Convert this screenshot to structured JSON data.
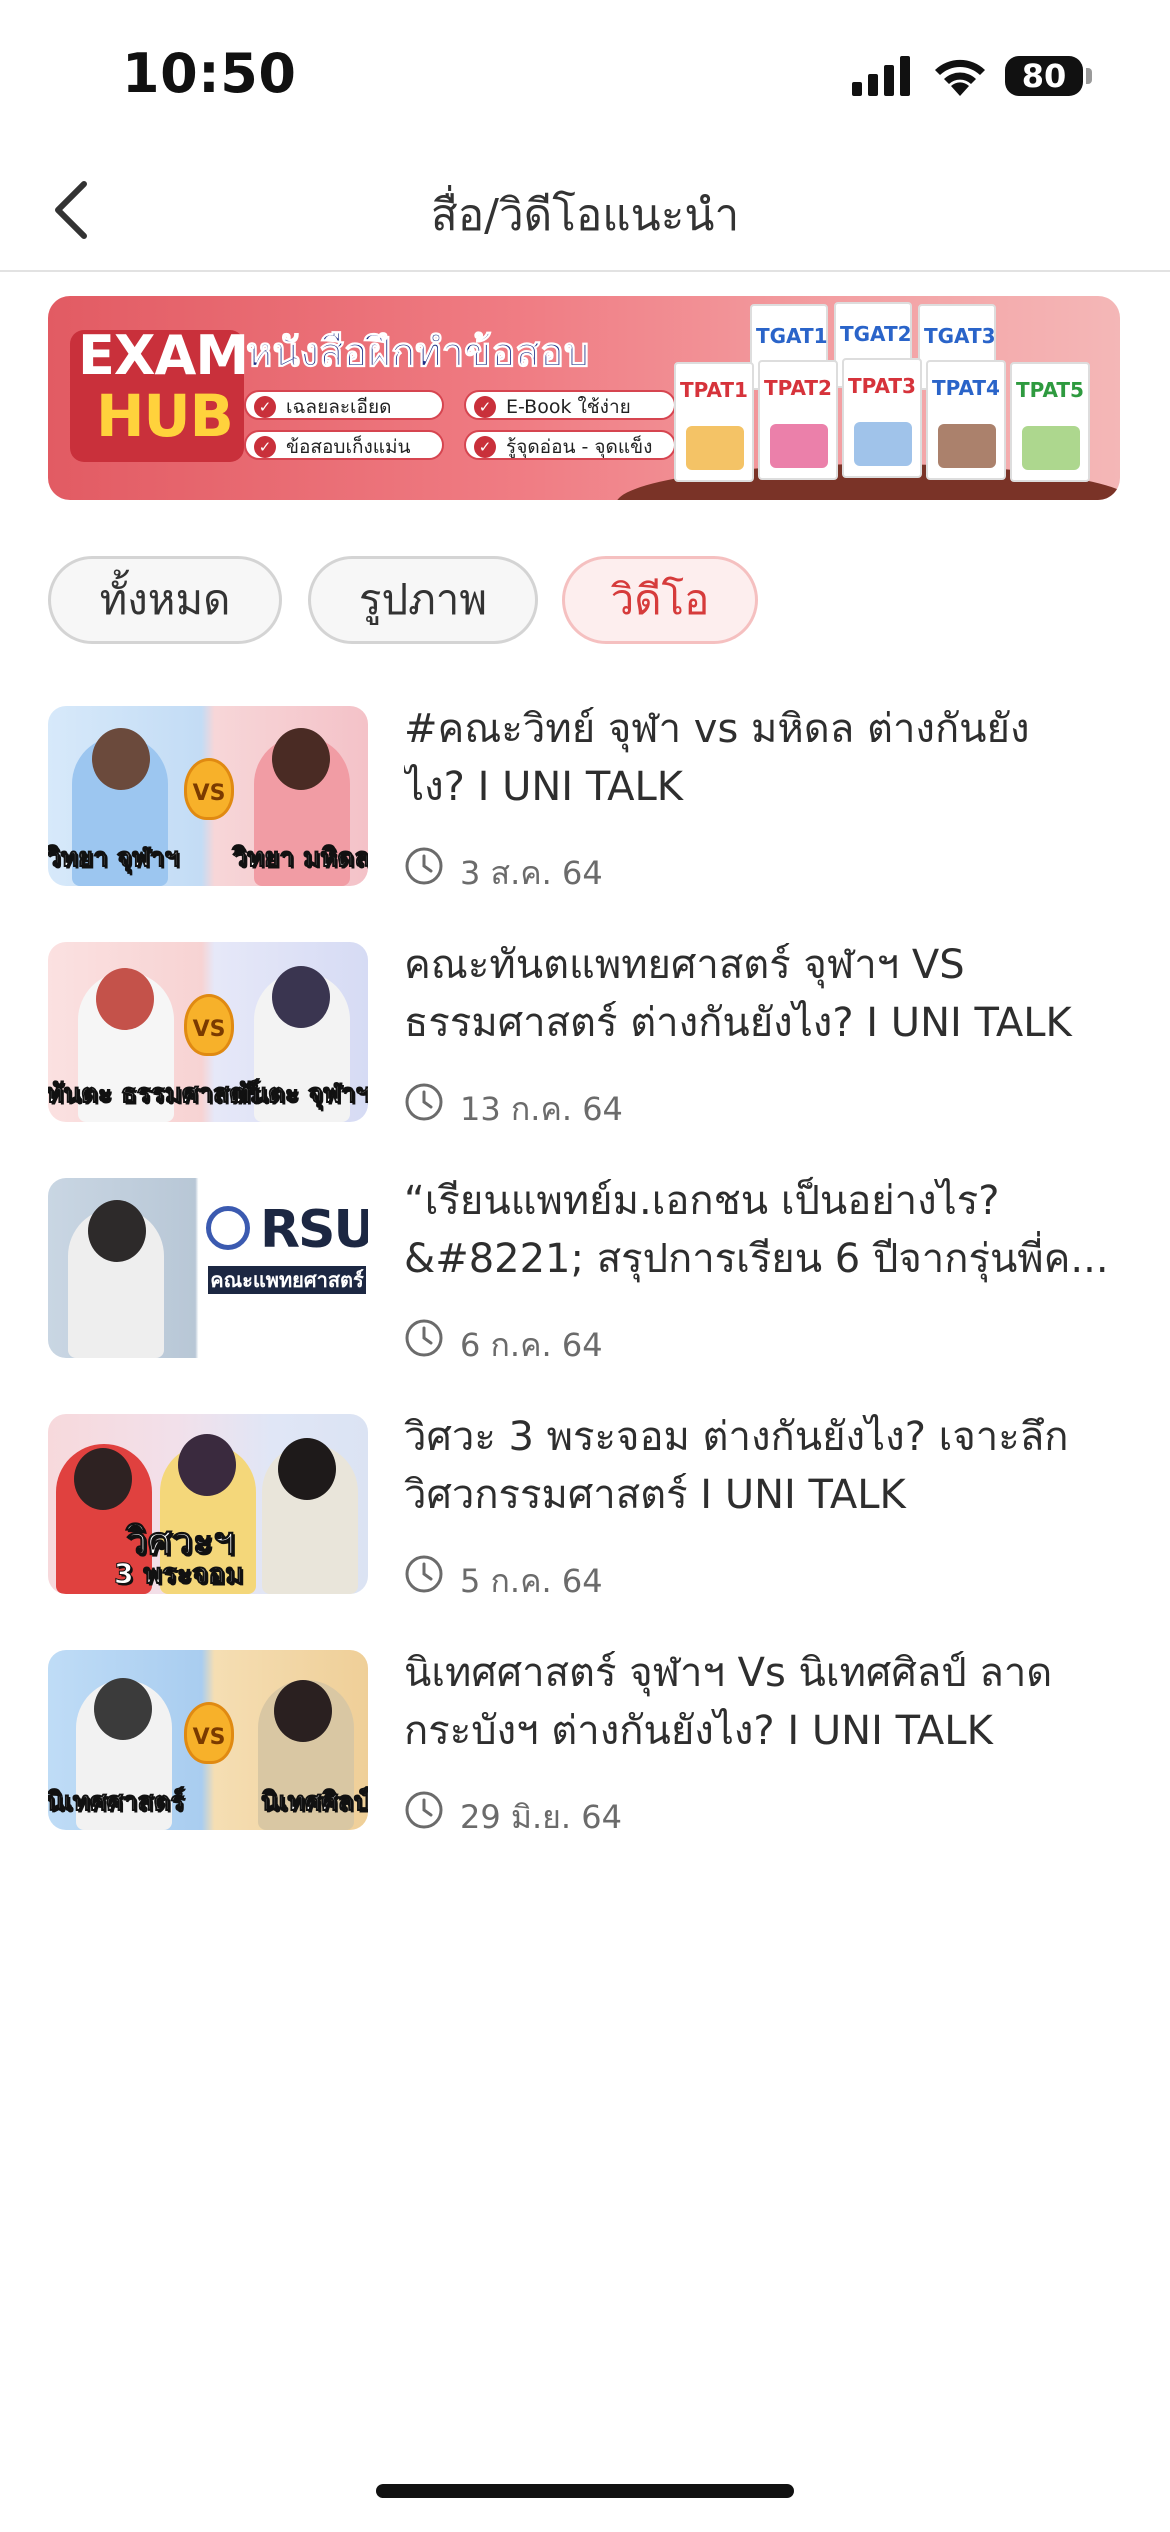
{
  "status_bar": {
    "time": "10:50",
    "battery": "80"
  },
  "nav": {
    "title": "สื่อ/วิดีโอแนะนำ",
    "back_icon": "chevron-left-icon"
  },
  "banner": {
    "logo_line1": "EXAM",
    "logo_line2": "HUB",
    "headline": "หนังสือฝึกทำข้อสอบ",
    "features": [
      "เฉลยละเอียด",
      "E-Book ใช้ง่ายสะดวก",
      "ข้อสอบเก็งแม่น",
      "รู้จุดอ่อน - จุดแข็ง"
    ],
    "books": [
      "TGAT1",
      "TGAT2",
      "TGAT3",
      "TPAT1",
      "TPAT2",
      "TPAT3",
      "TPAT4",
      "TPAT5"
    ]
  },
  "filters": {
    "items": [
      {
        "label": "ทั้งหมด",
        "active": false
      },
      {
        "label": "รูปภาพ",
        "active": false
      },
      {
        "label": "วิดีโอ",
        "active": true
      }
    ]
  },
  "videos": [
    {
      "title_line1": "#คณะวิทย์ จุฬา vs มหิดล ต่างกันยัง",
      "title_line2": "ไง? I UNI TALK",
      "date": "3 ส.ค. 64",
      "thumb_left": "วิทยา จุฬาฯ",
      "thumb_right": "วิทยา มหิดล"
    },
    {
      "title_line1": "คณะทันตแพทยศาสตร์ จุฬาฯ VS",
      "title_line2": "ธรรมศาสตร์ ต่างกันยังไง? I UNI TALK",
      "date": "13 ก.ค. 64",
      "thumb_left": "ทันตะ ธรรมศาสตร์",
      "thumb_right": "ทันตะ จุฬาฯ"
    },
    {
      "title_line1": "“เรียนแพทย์ม.เอกชน เป็นอย่างไร?",
      "title_line2": "&#8221; สรุปการเรียน 6 ปีจากรุ่นพี่ค...",
      "date": "6 ก.ค. 64",
      "thumb_brand": "RSU",
      "thumb_sub": "คณะแพทยศาสตร์"
    },
    {
      "title_line1": "วิศวะ 3 พระจอม ต่างกันยังไง? เจาะลึก",
      "title_line2": "วิศวกรรมศาสตร์ I UNI TALK",
      "date": "5 ก.ค. 64",
      "thumb_caption1": "วิศวะฯ",
      "thumb_caption2": "3 พระจอม"
    },
    {
      "title_line1": "นิเทศศาสตร์ จุฬาฯ Vs นิเทศศิลป์ ลาด",
      "title_line2": "กระบังฯ ต่างกันยังไง? I UNI TALK",
      "date": "29 มิ.ย. 64",
      "thumb_left": "นิเทศศาสตร์",
      "thumb_right": "นิเทศศิลป์"
    }
  ],
  "colors": {
    "accent": "#d63b3b",
    "chip_active_bg": "#fdeeee",
    "text": "#2e2e2e",
    "muted": "#6b6b6b"
  }
}
